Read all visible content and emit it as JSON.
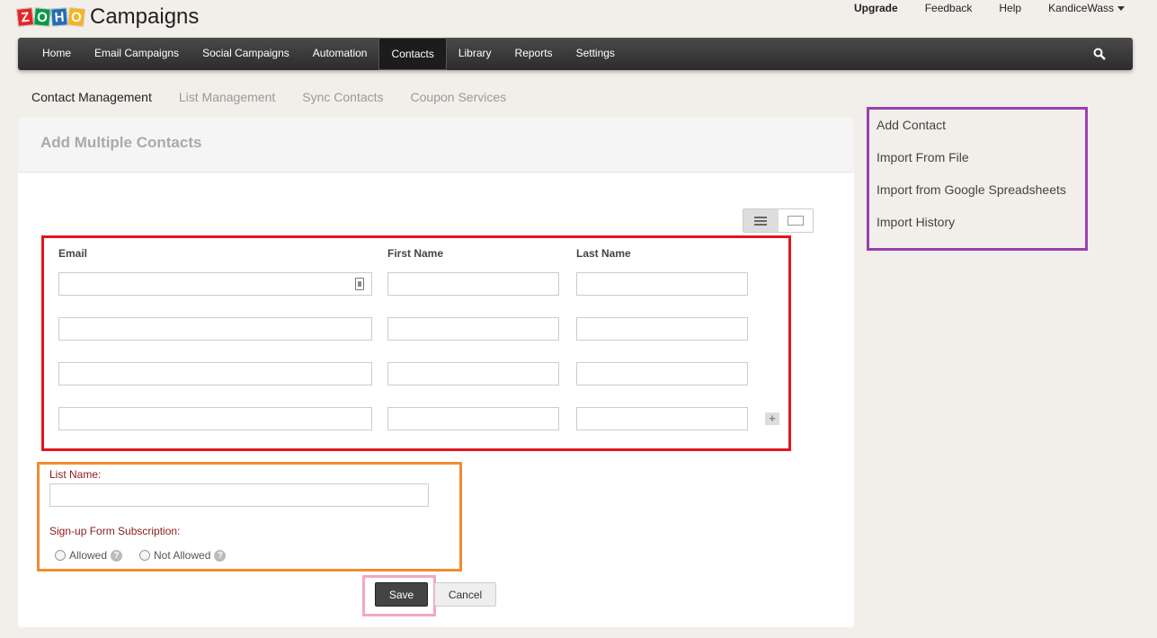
{
  "brand": {
    "logo_letters": [
      "Z",
      "O",
      "H",
      "O"
    ],
    "name": "Campaigns"
  },
  "top_links": {
    "upgrade": "Upgrade",
    "feedback": "Feedback",
    "help": "Help",
    "user": "KandiceWass"
  },
  "nav": {
    "items": [
      "Home",
      "Email Campaigns",
      "Social Campaigns",
      "Automation",
      "Contacts",
      "Library",
      "Reports",
      "Settings"
    ],
    "active": "Contacts"
  },
  "subnav": {
    "items": [
      "Contact Management",
      "List Management",
      "Sync Contacts",
      "Coupon Services"
    ],
    "active": "Contact Management"
  },
  "form": {
    "title": "Add Multiple Contacts",
    "columns": {
      "email": "Email",
      "first_name": "First Name",
      "last_name": "Last Name"
    },
    "rows": [
      {
        "email": "",
        "first_name": "",
        "last_name": ""
      },
      {
        "email": "",
        "first_name": "",
        "last_name": ""
      },
      {
        "email": "",
        "first_name": "",
        "last_name": ""
      },
      {
        "email": "",
        "first_name": "",
        "last_name": ""
      }
    ],
    "add_row": "+",
    "list_name_label": "List Name:",
    "list_name_value": "",
    "signup_label": "Sign-up Form Subscription:",
    "radio_allowed": "Allowed",
    "radio_not_allowed": "Not Allowed",
    "help": "?",
    "save": "Save",
    "cancel": "Cancel"
  },
  "sidebar": {
    "links": [
      "Add Contact",
      "Import From File",
      "Import from Google Spreadsheets",
      "Import History"
    ]
  },
  "colors": {
    "nav_bg": "#333333",
    "highlight_red": "#e3151e",
    "highlight_orange": "#f28b30",
    "highlight_pink": "#f4a6c6",
    "highlight_purple": "#9b3fb0",
    "label_red": "#8b1a1a"
  }
}
